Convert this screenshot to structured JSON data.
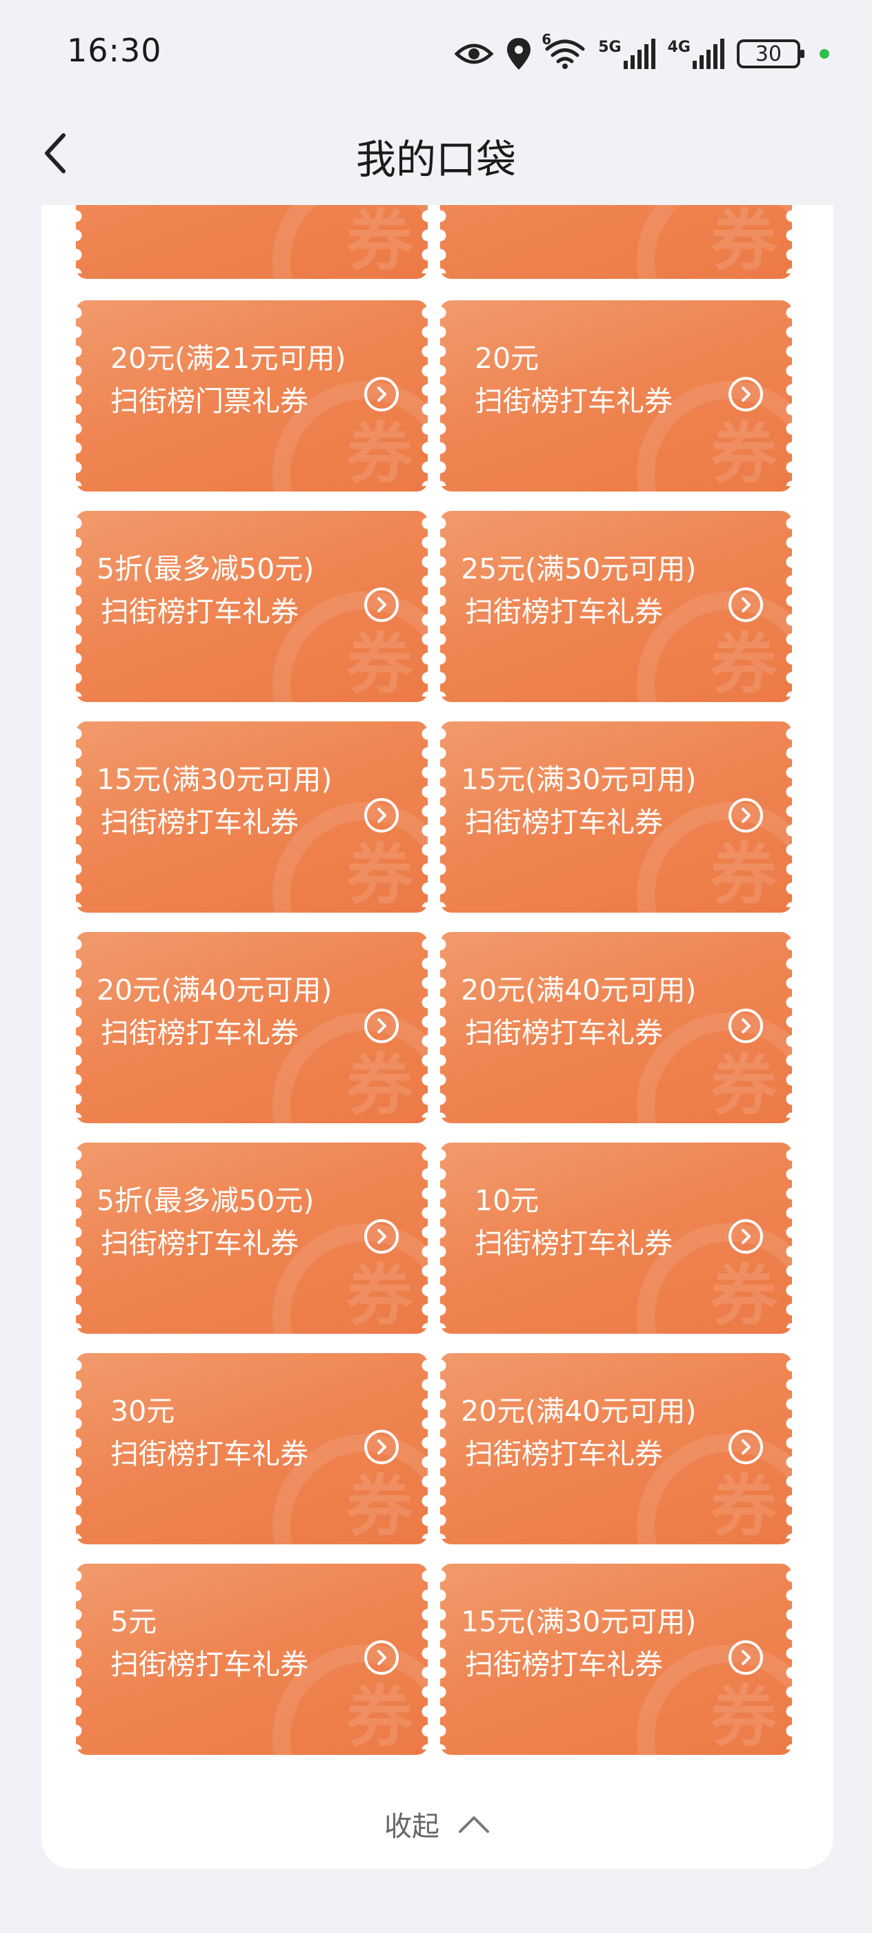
{
  "status_bar": {
    "time": "16:30",
    "battery": "30",
    "net1": "5G",
    "net2": "4G",
    "wifi_badge": "6"
  },
  "header": {
    "title": "我的口袋"
  },
  "coupons": [
    {
      "amount": "",
      "name": ""
    },
    {
      "amount": "",
      "name": ""
    },
    {
      "amount": "20元(满21元可用)",
      "name": "扫街榜门票礼券"
    },
    {
      "amount": "20元",
      "name": "扫街榜打车礼券"
    },
    {
      "amount": "5折(最多减50元)",
      "name": "扫街榜打车礼券"
    },
    {
      "amount": "25元(满50元可用)",
      "name": "扫街榜打车礼券"
    },
    {
      "amount": "15元(满30元可用)",
      "name": "扫街榜打车礼券"
    },
    {
      "amount": "15元(满30元可用)",
      "name": "扫街榜打车礼券"
    },
    {
      "amount": "20元(满40元可用)",
      "name": "扫街榜打车礼券"
    },
    {
      "amount": "20元(满40元可用)",
      "name": "扫街榜打车礼券"
    },
    {
      "amount": "5折(最多减50元)",
      "name": "扫街榜打车礼券"
    },
    {
      "amount": "10元",
      "name": "扫街榜打车礼券"
    },
    {
      "amount": "30元",
      "name": "扫街榜打车礼券"
    },
    {
      "amount": "20元(满40元可用)",
      "name": "扫街榜打车礼券"
    },
    {
      "amount": "5元",
      "name": "扫街榜打车礼券"
    },
    {
      "amount": "15元(满30元可用)",
      "name": "扫街榜打车礼券"
    }
  ],
  "watermark": "券",
  "collapse": {
    "label": "收起"
  },
  "colors": {
    "coupon": "#ef8552",
    "background": "#f1f2f6",
    "card": "#ffffff"
  },
  "icons": [
    "back-arrow-icon",
    "eye-icon",
    "location-icon",
    "wifi-icon",
    "signal-icon",
    "battery-icon",
    "chevron-circle-right-icon",
    "chevron-up-icon"
  ]
}
